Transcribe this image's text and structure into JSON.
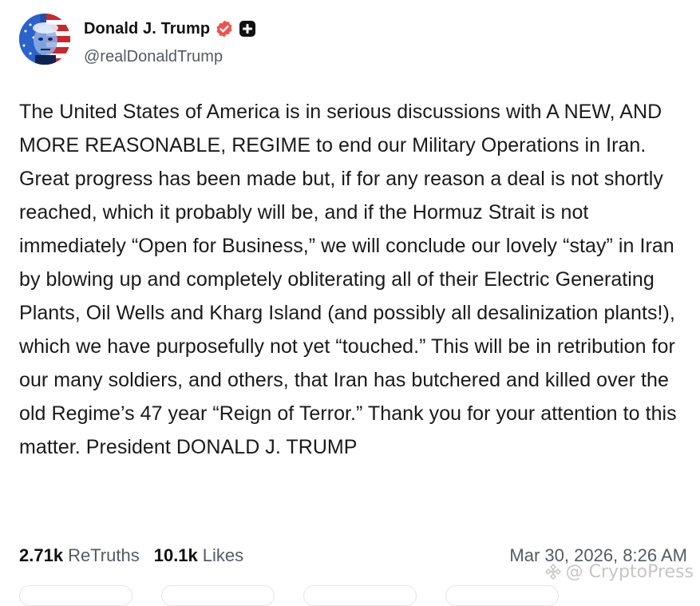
{
  "author": {
    "display_name": "Donald J. Trump",
    "handle": "@realDonaldTrump",
    "verified_icon": "verified-badge-icon",
    "verified_color": "#f0524c",
    "extra_icon": "plus-square-icon"
  },
  "post": {
    "text": "The United States of America is in serious discussions with A NEW, AND MORE REASONABLE, REGIME to end our Military Operations in Iran. Great progress has been made but, if for any reason a deal is not shortly reached, which it probably will be, and if the Hormuz Strait is not immediately “Open for Business,” we will conclude our lovely “stay” in Iran by blowing up and completely obliterating all of their Electric Generating Plants, Oil Wells and Kharg Island (and possibly all desalinization plants!), which we have purposefully not yet “touched.” This will be in retribution for our many soldiers, and others, that Iran has butchered and killed over the old Regime’s 47 year “Reign of Terror.” Thank you for your attention to this matter. President DONALD J. TRUMP"
  },
  "stats": {
    "retruths_count": "2.71k",
    "retruths_label": "ReTruths",
    "likes_count": "10.1k",
    "likes_label": "Likes"
  },
  "timestamp": "Mar 30, 2026, 8:26 AM",
  "watermark": {
    "text": "@ CryptoPress"
  },
  "colors": {
    "text_primary": "#111111",
    "text_secondary": "#555a62",
    "badge": "#f0524c"
  }
}
